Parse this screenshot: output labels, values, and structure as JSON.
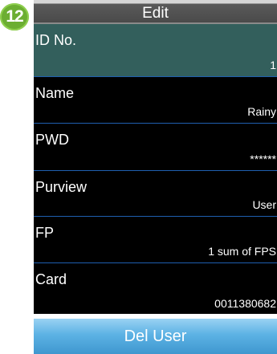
{
  "step_badge": "12",
  "header": {
    "title": "Edit"
  },
  "fields": [
    {
      "label": "ID No.",
      "value": "1"
    },
    {
      "label": "Name",
      "value": "Rainy"
    },
    {
      "label": "PWD",
      "value": "******"
    },
    {
      "label": "Purview",
      "value": "User"
    },
    {
      "label": "FP",
      "value": "1 sum of FPS"
    },
    {
      "label": "Card",
      "value": "0011380682"
    }
  ],
  "actions": {
    "del_user_label": "Del User"
  },
  "colors": {
    "badge": "#6cae32",
    "selected_row": "#335f5c",
    "row_divider": "#1f5fb0",
    "button": "#5cb2e4"
  }
}
